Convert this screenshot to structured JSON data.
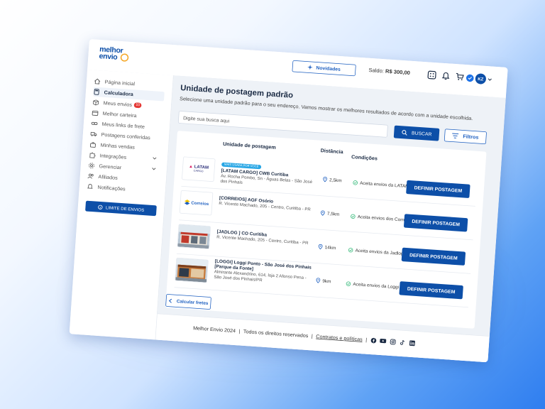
{
  "app": {
    "logo_line1": "melhor",
    "logo_line2": "envio"
  },
  "header": {
    "novidades_label": "Novidades",
    "saldo_label": "Saldo:",
    "saldo_value": "R$ 300,00",
    "user_initials": "KZ"
  },
  "sidebar": {
    "items": [
      {
        "label": "Página inicial",
        "icon": "home-icon"
      },
      {
        "label": "Calculadora",
        "icon": "calculator-icon"
      },
      {
        "label": "Meus envios",
        "icon": "box-icon",
        "badge": "10"
      },
      {
        "label": "Melhor carteira",
        "icon": "wallet-icon"
      },
      {
        "label": "Meus links de frete",
        "icon": "link-icon"
      },
      {
        "label": "Postagens conferidas",
        "icon": "truck-icon"
      },
      {
        "label": "Minhas vendas",
        "icon": "bag-icon"
      },
      {
        "label": "Integrações",
        "icon": "puzzle-icon"
      },
      {
        "label": "Gerenciar",
        "icon": "settings-icon"
      },
      {
        "label": "Afiliados",
        "icon": "users-icon"
      },
      {
        "label": "Notificações",
        "icon": "bell-icon"
      }
    ],
    "limite_label": "LIMITE DE ENVIOS"
  },
  "main": {
    "title": "Unidade de postagem padrão",
    "subtitle": "Selecione uma unidade padrão para o seu endereço. Vamos mostrar os melhores resultados de acordo com a unidade escolhida.",
    "search_placeholder": "Digite sua busca aqui",
    "buscar_label": "BUSCAR",
    "filtros_label": "Filtros",
    "columns": [
      "Unidade de postagem",
      "Distância",
      "Condições"
    ],
    "rows": [
      {
        "tag": "MAIS USADA POR VOCÊ",
        "name": "[LATAM CARGO] CWB Curitiba",
        "address": "Av. Rocha Pombo, Sn - Águas Belas - São José dos Pinhais",
        "distance": "2,5km",
        "condition": "Aceita envios da LATAM",
        "button": "DEFINIR POSTAGEM",
        "thumb": "latam",
        "thumb_text": "LATAM",
        "thumb_sub": "CARGO"
      },
      {
        "tag": "",
        "name": "[CORREIOS] AGF Osório",
        "address": "R. Vicente Machado, 205 - Centro, Curitiba - PR",
        "distance": "7,5km",
        "condition": "Aceita envios dos Correios",
        "button": "DEFINIR POSTAGEM",
        "thumb": "correios",
        "thumb_text": "Correios",
        "thumb_sub": ""
      },
      {
        "tag": "",
        "name": "[JADLOG ] CO Curitiba",
        "address": "R. Vicente Machado, 205 - Centro, Curitiba - PR",
        "distance": "14km",
        "condition": "Aceita envios da Jadlog",
        "button": "DEFINIR POSTAGEM",
        "thumb": "jadlog",
        "thumb_text": "",
        "thumb_sub": ""
      },
      {
        "tag": "",
        "name": "[LOGGI] Loggi Ponto - São José dos Pinhais [Parque da Fonte]",
        "address": "Almirante Alexandrino, 614, loja 2 Afonso Pena - São José dos Pinhais/PR",
        "distance": "9km",
        "condition": "Aceita envios da Loggi",
        "button": "DEFINIR POSTAGEM",
        "thumb": "loggi",
        "thumb_text": "",
        "thumb_sub": ""
      }
    ],
    "calc_label": "Calcular fretes"
  },
  "footer": {
    "brand": "Melhor Envio 2024",
    "rights": "Todos os direitos reservados",
    "link": "Contratos e políticas",
    "social": [
      "facebook-icon",
      "youtube-icon",
      "instagram-icon",
      "tiktok-icon",
      "linkedin-icon"
    ]
  },
  "colors": {
    "primary": "#0d4fa8",
    "accent": "#f5a623",
    "success": "#2bb673",
    "badge": "#e53935"
  }
}
